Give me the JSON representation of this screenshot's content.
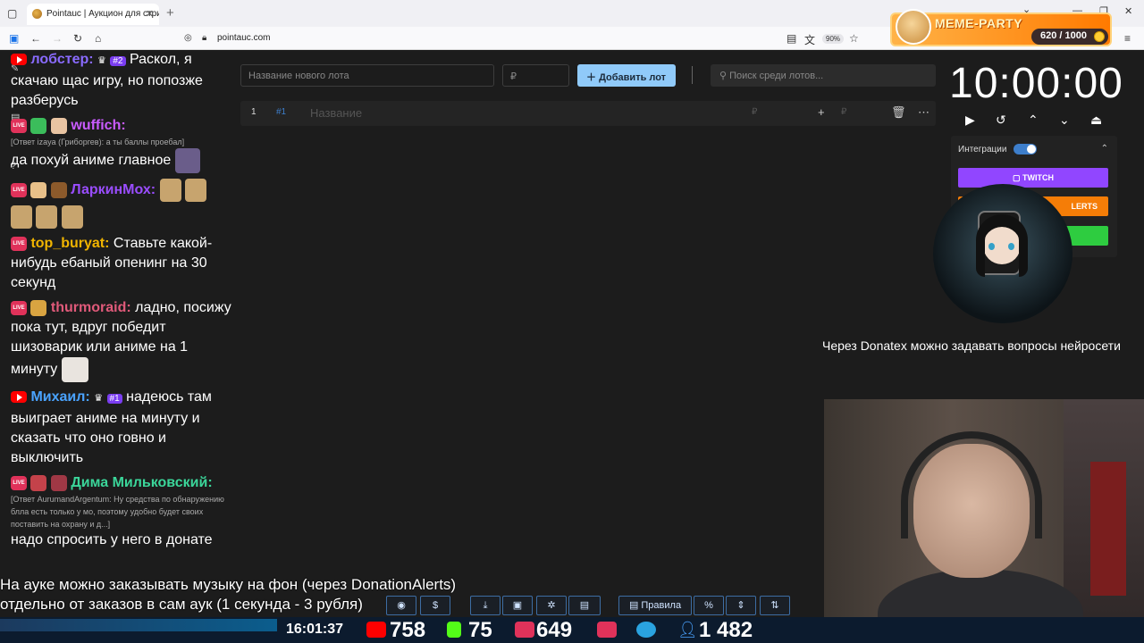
{
  "browser": {
    "tab_title": "Pointauc | Аукцион для стриме",
    "url": "pointauc.com",
    "zoom": "90%"
  },
  "meme_party": {
    "title": "MEME-PARTY",
    "score": "620 / 1000"
  },
  "chat": [
    {
      "nick": "лобстер:",
      "nick_color": "#8a6bff",
      "badge": "#2",
      "text": "Раскол, я скачаю щас игру, но попозже разберусь"
    },
    {
      "nick": "wuffich:",
      "nick_color": "#c95bff",
      "reply": "[Ответ izaya (Гриборгев): а ты баллы проебал]",
      "text": "да похуй аниме главное"
    },
    {
      "nick": "ЛаркинМох:",
      "nick_color": "#9a4dff",
      "text": ""
    },
    {
      "nick": "top_buryat:",
      "nick_color": "#f0b400",
      "text": "Ставьте какой-нибудь ебаный опенинг на 30 секунд"
    },
    {
      "nick": "thurmoraid:",
      "nick_color": "#e05a7a",
      "text": "ладно, посижу пока тут, вдруг победит шизоварик или аниме на 1 минуту"
    },
    {
      "nick": "Михаил:",
      "nick_color": "#4aa3ff",
      "badge": "#1",
      "text": "надеюсь там выиграет аниме на минуту и сказать что оно говно и выключить"
    },
    {
      "nick": "Дима Мильковский:",
      "nick_color": "#3bd69a",
      "reply": "[Ответ AurumandArgentum: Ну средства по обнаружению блла есть только у мо, поэтому удобно будет своих поставить на охрану и д...]",
      "text": "надо спросить у него в донате"
    }
  ],
  "auction": {
    "lot_placeholder": "Название нового лота",
    "price_placeholder": "₽",
    "add_button": "Добавить лот",
    "search_placeholder": "Поиск среди лотов...",
    "row": {
      "num": "1",
      "id": "#1",
      "name": "Название",
      "currency": "₽"
    }
  },
  "timer": {
    "value": "10:00:00"
  },
  "integrations": {
    "label": "Интеграции",
    "enabled": true,
    "twitch": "TWITCH",
    "alerts": "LERTS"
  },
  "donatex_text": "Через Donatex можно задавать вопросы нейросети",
  "music_text_1": "На ауке можно заказывать музыку на фон (через DonationAlerts)",
  "music_text_2": "отдельно от заказов в сам аук (1 секунда - 3 рубля)",
  "toolbar": {
    "rules": "Правила",
    "percent": "%"
  },
  "stats": {
    "clock": "16:01:37",
    "youtube": "758",
    "kick": "75",
    "twitch": "649",
    "telegram": "",
    "viewers": "1 482"
  },
  "colors": {
    "accent": "#90caf9",
    "twitch": "#9146ff",
    "alerts": "#f57d07",
    "green": "#2ecc40"
  }
}
